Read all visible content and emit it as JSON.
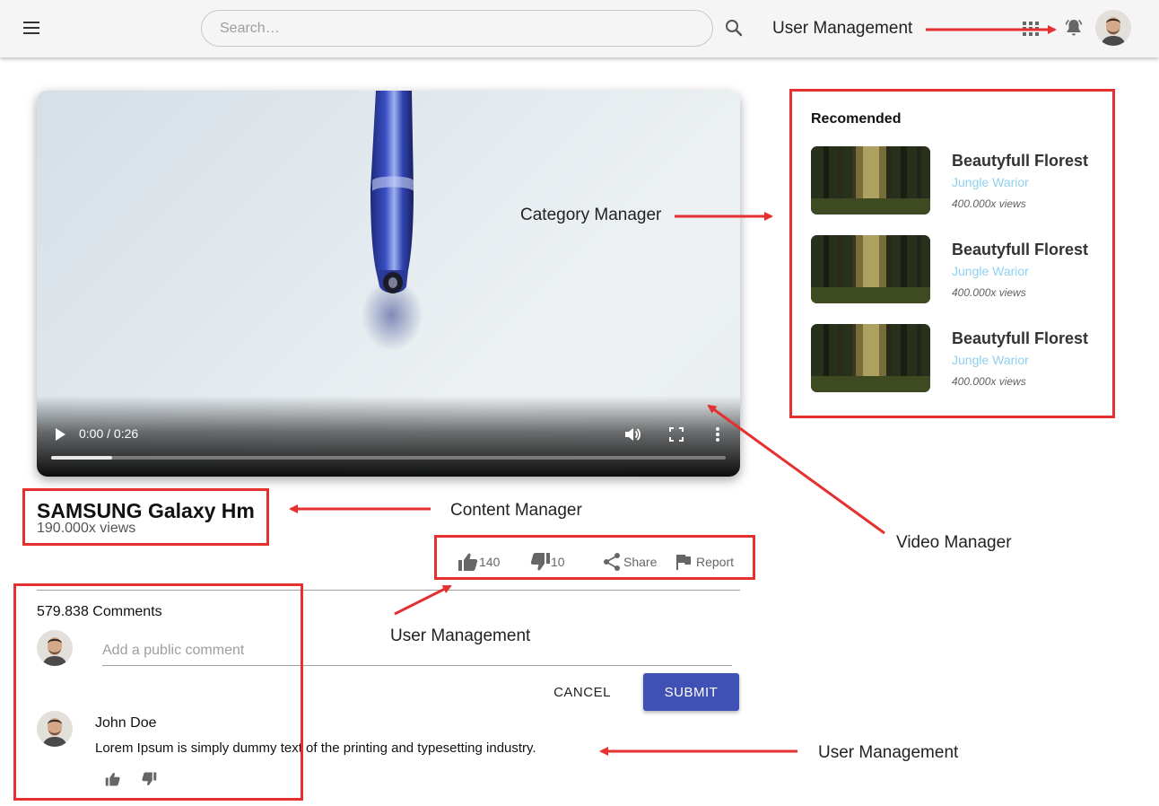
{
  "header": {
    "search_placeholder": "Search…",
    "annotation_label": "User Management",
    "icons": [
      "menu-icon",
      "search-icon",
      "apps-icon",
      "bell-icon",
      "avatar"
    ]
  },
  "video": {
    "time": "0:00 / 0:26",
    "progress": 0.09,
    "title": "SAMSUNG Galaxy Hm",
    "views": "190.000x views"
  },
  "recommended": {
    "heading": "Recomended",
    "items": [
      {
        "title": "Beautyfull Florest",
        "channel": "Jungle Warior",
        "views": "400.000x views"
      },
      {
        "title": "Beautyfull Florest",
        "channel": "Jungle Warior",
        "views": "400.000x views"
      },
      {
        "title": "Beautyfull Florest",
        "channel": "Jungle Warior",
        "views": "400.000x views"
      }
    ]
  },
  "actions": {
    "likes": "140",
    "dislikes": "10",
    "share_label": "Share",
    "report_label": "Report"
  },
  "comments": {
    "count_label": "579.838 Comments",
    "input_placeholder": "Add a public comment",
    "cancel_label": "CANCEL",
    "submit_label": "SUBMIT",
    "items": [
      {
        "author": "John Doe",
        "text": "Lorem Ipsum is simply dummy text of the printing and typesetting industry."
      }
    ]
  },
  "annotations": {
    "category_manager": "Category Manager",
    "content_manager": "Content Manager",
    "video_manager": "Video Manager",
    "user_management_actions": "User Management",
    "user_management_comments": "User Management"
  },
  "colors": {
    "annotation_red": "#e53030",
    "submit_blue": "#3f51b5",
    "channel_link": "#8fd0f0",
    "topbar_bg": "#f5f5f5"
  }
}
